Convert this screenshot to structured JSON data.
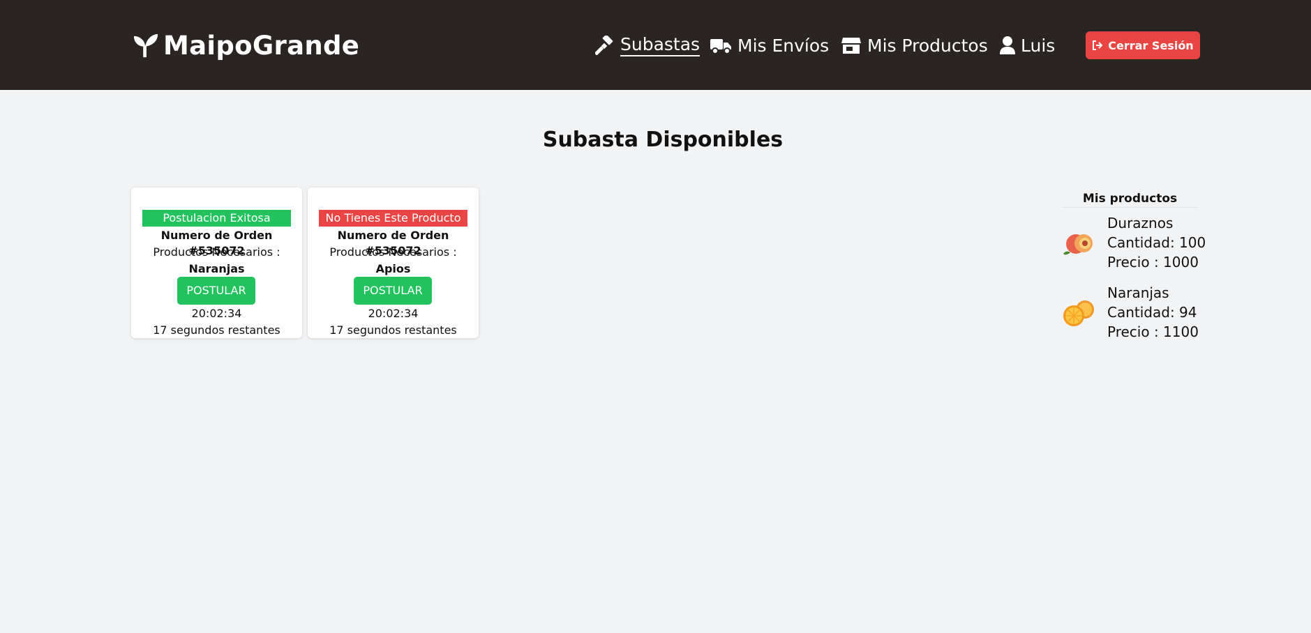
{
  "header": {
    "brand": "MaipoGrande",
    "nav": [
      {
        "label": "Subastas",
        "icon": "gavel-icon",
        "active": true
      },
      {
        "label": "Mis Envíos",
        "icon": "truck-icon"
      },
      {
        "label": "Mis Productos",
        "icon": "store-icon"
      },
      {
        "label": "Luis",
        "icon": "user-icon"
      }
    ],
    "logout": {
      "label": "Cerrar Sesión",
      "icon": "logout-icon"
    }
  },
  "page": {
    "title": "Subasta Disponibles"
  },
  "auctions": [
    {
      "status": "Postulacion Exitosa",
      "status_color": "#22c35e",
      "order": "Numero de Orden #535072",
      "needed_label": "Productos Necesarios :",
      "product": "Naranjas",
      "action": "POSTULAR",
      "time": "20:02:34",
      "remaining": "17 segundos restantes"
    },
    {
      "status": "No Tienes Este Producto",
      "status_color": "#ea4444",
      "order": "Numero de Orden #535072",
      "needed_label": "Productos Necesarios :",
      "product": "Apios",
      "action": "POSTULAR",
      "time": "20:02:34",
      "remaining": "17 segundos restantes"
    }
  ],
  "my_products": {
    "title": "Mis productos",
    "items": [
      {
        "name": "Duraznos",
        "quantity": "Cantidad: 100",
        "price": "Precio : 1000",
        "icon": "peach-icon"
      },
      {
        "name": "Naranjas",
        "quantity": "Cantidad: 94",
        "price": "Precio : 1100",
        "icon": "orange-icon"
      }
    ]
  },
  "colors": {
    "header_bg": "#2a2523",
    "success": "#22c35e",
    "danger": "#ea4444",
    "page_bg": "#f2f3f5"
  }
}
